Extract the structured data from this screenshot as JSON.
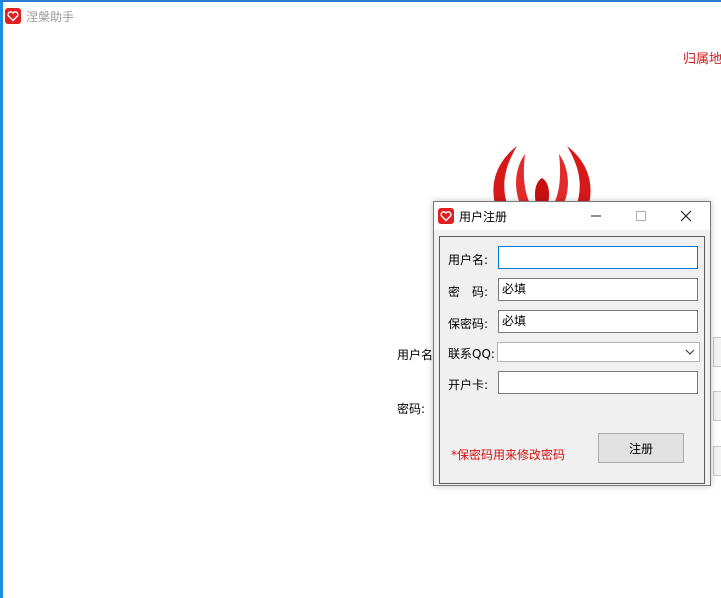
{
  "main_window": {
    "title": "涅槃助手",
    "region_label": "归属地:",
    "username_label": "用户名",
    "password_label": "密码:"
  },
  "dialog": {
    "title": "用户注册",
    "fields": {
      "username": {
        "label": "用户名:",
        "value": ""
      },
      "password": {
        "label": "密　码:",
        "value": "必填"
      },
      "security_password": {
        "label": "保密码:",
        "value": "必填"
      },
      "qq": {
        "label": "联系QQ:",
        "value": ""
      },
      "card": {
        "label": "开户卡:",
        "value": ""
      }
    },
    "hint": "*保密码用来修改密码",
    "register_label": "注册"
  },
  "colors": {
    "accent_blue": "#1e8fe0",
    "brand_red": "#e02020",
    "hint_red": "#d01010"
  },
  "icons": {
    "app": "heart-logo-icon",
    "minimize": "minimize-icon",
    "maximize": "maximize-icon",
    "close": "close-icon",
    "dropdown": "chevron-down-icon"
  }
}
